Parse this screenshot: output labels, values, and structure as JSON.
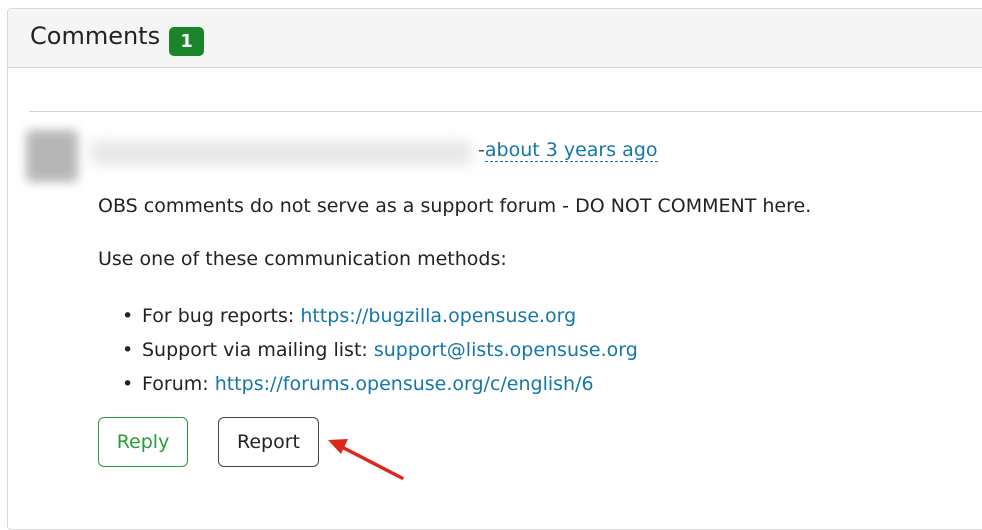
{
  "header": {
    "title": "Comments",
    "count": "1"
  },
  "comment": {
    "separator": "-",
    "time_ago": "about 3 years ago",
    "paragraph1": "OBS comments do not serve as a support forum - DO NOT COMMENT here.",
    "paragraph2": "Use one of these communication methods:",
    "methods": [
      {
        "label": "For bug reports: ",
        "link": "https://bugzilla.opensuse.org"
      },
      {
        "label": "Support via mailing list: ",
        "link": "support@lists.opensuse.org"
      },
      {
        "label": "Forum: ",
        "link": "https://forums.opensuse.org/c/english/6"
      }
    ],
    "bullet": "•"
  },
  "actions": {
    "reply_label": "Reply",
    "report_label": "Report"
  },
  "colors": {
    "badge": "#19842a",
    "link": "#1577a8",
    "reply": "#2b9a3a",
    "annotation_arrow": "#e0251b"
  }
}
